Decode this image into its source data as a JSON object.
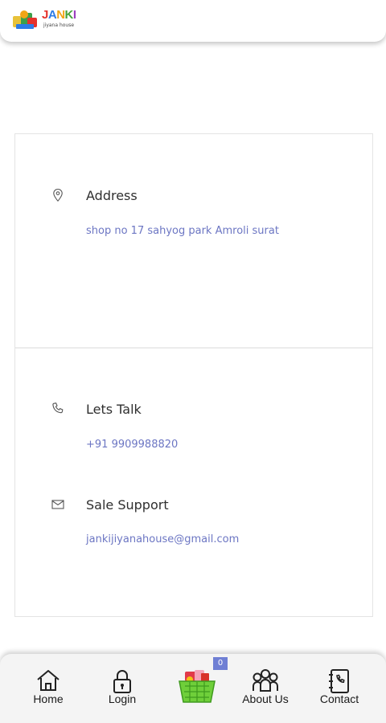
{
  "header": {
    "logo_word": [
      "J",
      "A",
      "N",
      "K",
      "I"
    ],
    "logo_subtitle": "jiyana house"
  },
  "contact": {
    "address": {
      "title": "Address",
      "value": "shop no 17 sahyog park Amroli surat",
      "icon": "map-pin-icon"
    },
    "phone": {
      "title": "Lets Talk",
      "value": "+91 9909988820",
      "icon": "phone-icon"
    },
    "email": {
      "title": "Sale Support",
      "value": "jankijiyanahouse@gmail.com",
      "icon": "mail-icon"
    }
  },
  "bottom_nav": {
    "items": [
      {
        "label": "Home",
        "icon": "home-icon"
      },
      {
        "label": "Login",
        "icon": "lock-icon"
      },
      {
        "label": "",
        "icon": "basket-icon"
      },
      {
        "label": "About Us",
        "icon": "users-icon"
      },
      {
        "label": "Contact",
        "icon": "contact-book-icon"
      }
    ],
    "cart_count": "0"
  },
  "colors": {
    "link": "#6c76c3",
    "badge": "#6f7fd4",
    "basket": "#6fcf3a"
  }
}
